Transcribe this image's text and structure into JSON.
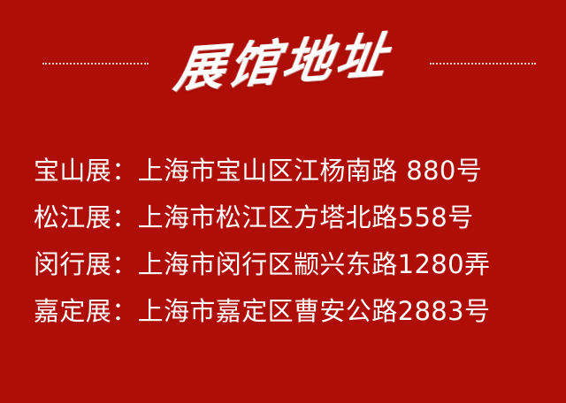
{
  "header": {
    "title": "展馆地址"
  },
  "addresses": [
    {
      "text": "宝山展：上海市宝山区江杨南路 880号"
    },
    {
      "text": "松江展：上海市松江区方塔北路558号"
    },
    {
      "text": "闵行展：上海市闵行区颛兴东路1280弄"
    },
    {
      "text": "嘉定展：上海市嘉定区曹安公路2883号"
    }
  ],
  "colors": {
    "background": "#ae0e05",
    "text": "#ffffff",
    "divider": "#f3d7d1"
  }
}
